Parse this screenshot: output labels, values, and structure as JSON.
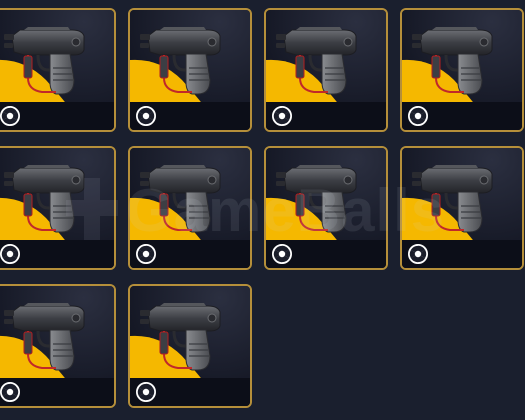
{
  "grid": {
    "items": [
      {
        "item": "stun-gun",
        "rarity_color": "#f5b800"
      },
      {
        "item": "stun-gun",
        "rarity_color": "#f5b800"
      },
      {
        "item": "stun-gun",
        "rarity_color": "#f5b800"
      },
      {
        "item": "stun-gun",
        "rarity_color": "#f5b800"
      },
      {
        "item": "stun-gun",
        "rarity_color": "#f5b800"
      },
      {
        "item": "stun-gun",
        "rarity_color": "#f5b800"
      },
      {
        "item": "stun-gun",
        "rarity_color": "#f5b800"
      },
      {
        "item": "stun-gun",
        "rarity_color": "#f5b800"
      },
      {
        "item": "stun-gun",
        "rarity_color": "#f5b800"
      },
      {
        "item": "stun-gun",
        "rarity_color": "#f5b800"
      }
    ],
    "badge_icon": "aperture-icon",
    "border_color": "#b58f3a"
  },
  "watermark": {
    "text": "GameBalls",
    "icon": "logo-cross-icon"
  }
}
